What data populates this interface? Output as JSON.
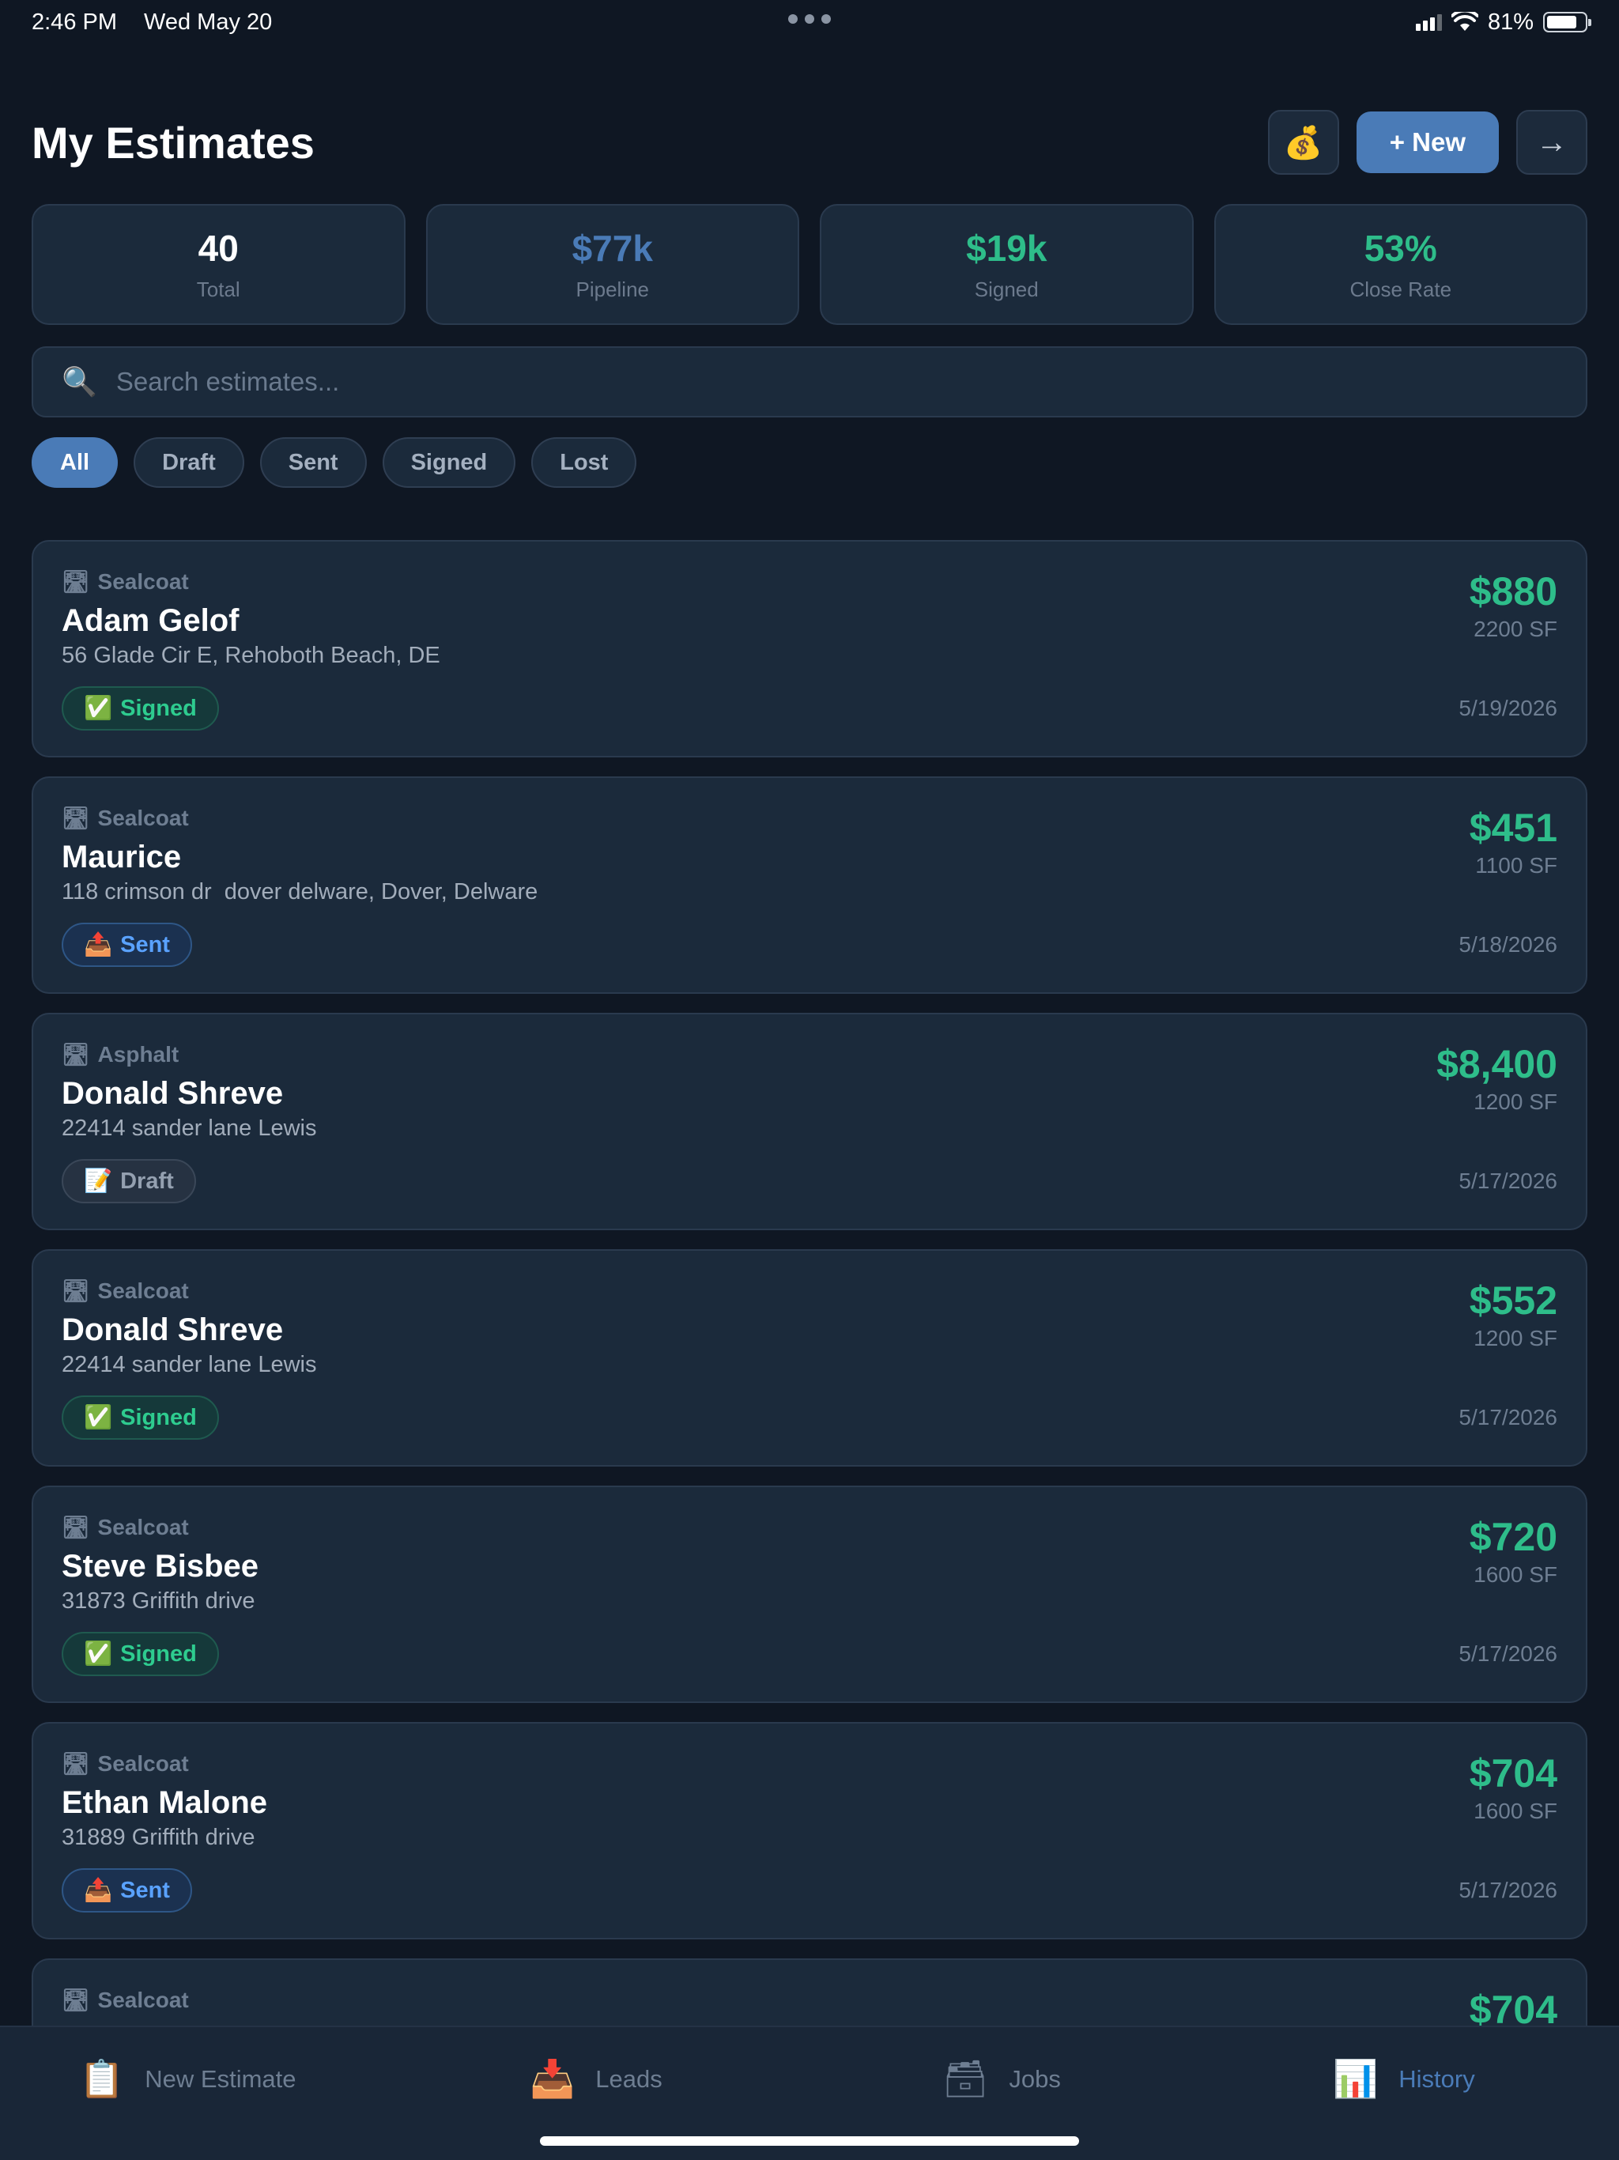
{
  "status": {
    "time": "2:46 PM",
    "date": "Wed May 20",
    "battery": "81%",
    "battery_level": 0.81
  },
  "header": {
    "title": "My Estimates",
    "money_icon": "money-bag-icon",
    "new_label": "+ New",
    "forward_icon": "arrow-right-icon"
  },
  "stats": [
    {
      "value": "40",
      "label": "Total",
      "color": "#ffffff"
    },
    {
      "value": "$77k",
      "label": "Pipeline",
      "color": "#4a7bb7"
    },
    {
      "value": "$19k",
      "label": "Signed",
      "color": "#2ebd8a"
    },
    {
      "value": "53%",
      "label": "Close Rate",
      "color": "#2ebd8a"
    }
  ],
  "search": {
    "placeholder": "Search estimates..."
  },
  "filters": [
    {
      "label": "All",
      "active": true
    },
    {
      "label": "Draft",
      "active": false
    },
    {
      "label": "Sent",
      "active": false
    },
    {
      "label": "Signed",
      "active": false
    },
    {
      "label": "Lost",
      "active": false
    }
  ],
  "estimates": [
    {
      "type": "Sealcoat",
      "name": "Adam Gelof",
      "address": "56 Glade Cir E, Rehoboth Beach, DE",
      "status": "Signed",
      "amount": "$880",
      "sf": "2200 SF",
      "date": "5/19/2026"
    },
    {
      "type": "Sealcoat",
      "name": "Maurice",
      "address": "118 crimson dr  dover delware, Dover, Delware",
      "status": "Sent",
      "amount": "$451",
      "sf": "1100 SF",
      "date": "5/18/2026"
    },
    {
      "type": "Asphalt",
      "name": "Donald Shreve",
      "address": "22414 sander lane Lewis",
      "status": "Draft",
      "amount": "$8,400",
      "sf": "1200 SF",
      "date": "5/17/2026"
    },
    {
      "type": "Sealcoat",
      "name": "Donald Shreve",
      "address": "22414 sander lane Lewis",
      "status": "Signed",
      "amount": "$552",
      "sf": "1200 SF",
      "date": "5/17/2026"
    },
    {
      "type": "Sealcoat",
      "name": "Steve Bisbee",
      "address": "31873 Griffith drive",
      "status": "Signed",
      "amount": "$720",
      "sf": "1600 SF",
      "date": "5/17/2026"
    },
    {
      "type": "Sealcoat",
      "name": "Ethan Malone",
      "address": "31889 Griffith drive",
      "status": "Sent",
      "amount": "$704",
      "sf": "1600 SF",
      "date": "5/17/2026"
    },
    {
      "type": "Sealcoat",
      "name": "",
      "address": "",
      "status": "",
      "amount": "$704",
      "sf": "",
      "date": ""
    }
  ],
  "tabs": [
    {
      "label": "New Estimate",
      "icon": "clipboard-icon",
      "active": false
    },
    {
      "label": "Leads",
      "icon": "inbox-icon",
      "active": false
    },
    {
      "label": "Jobs",
      "icon": "card-box-icon",
      "active": false
    },
    {
      "label": "History",
      "icon": "bar-chart-icon",
      "active": true
    }
  ]
}
